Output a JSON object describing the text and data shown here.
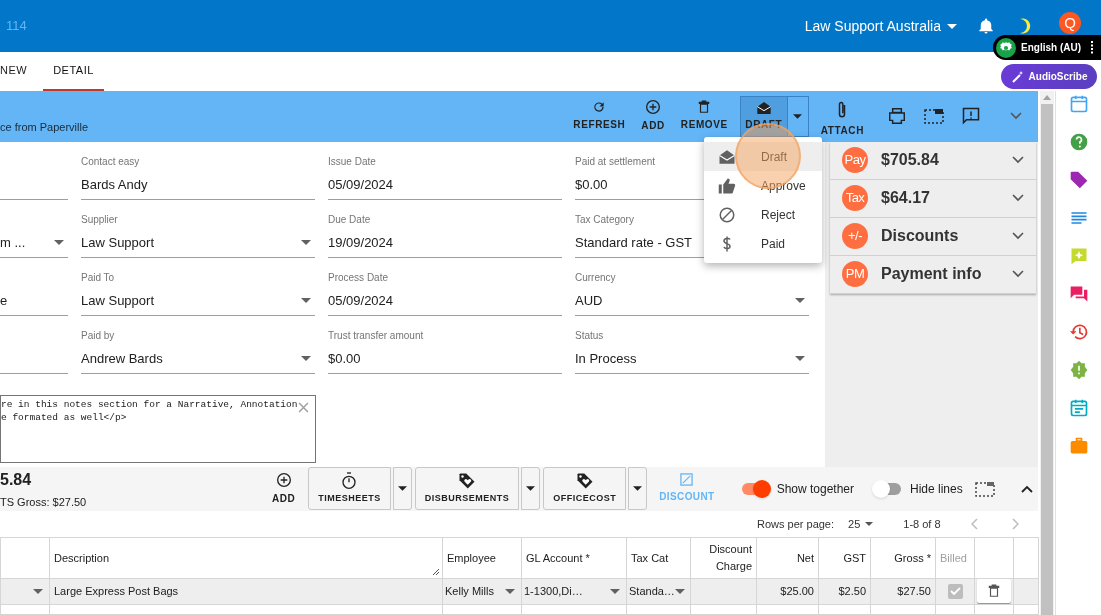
{
  "header": {
    "record_number": "114",
    "organisation": "Law Support Australia",
    "avatar_initial": "Q"
  },
  "overlays": {
    "language": "English (AU)",
    "assistant": "AudioScribe"
  },
  "tabs": [
    {
      "label": "NEW",
      "selected": false
    },
    {
      "label": "DETAIL",
      "selected": true
    }
  ],
  "toolbar": {
    "subtitle": "ce from Paperville",
    "buttons": [
      {
        "kind": "refresh",
        "label": "REFRESH"
      },
      {
        "kind": "add",
        "label": "ADD"
      },
      {
        "kind": "remove",
        "label": "REMOVE"
      },
      {
        "kind": "split",
        "label": "DRAFT"
      },
      {
        "kind": "attach",
        "label": "ATTACH"
      }
    ]
  },
  "status_menu": [
    {
      "label": "Draft",
      "selected": true
    },
    {
      "label": "Approve",
      "selected": false
    },
    {
      "label": "Reject",
      "selected": false
    },
    {
      "label": "Paid",
      "selected": false
    }
  ],
  "form": {
    "fields": [
      {
        "kind": "text"
      },
      {
        "kind": "text",
        "label": "Contact easy",
        "value": "Bards Andy"
      },
      {
        "kind": "text",
        "label": "Issue Date",
        "value": "05/09/2024"
      },
      {
        "kind": "text",
        "label": "Paid at settlement",
        "value": "$0.00"
      },
      {
        "kind": "select",
        "value": "m ..."
      },
      {
        "kind": "select",
        "label": "Supplier",
        "value": "Law Support"
      },
      {
        "kind": "text",
        "label": "Due Date",
        "value": "19/09/2024"
      },
      {
        "kind": "text",
        "label": "Tax Category",
        "value": "Standard rate - GST"
      },
      {
        "kind": "text",
        "value": "e"
      },
      {
        "kind": "select",
        "label": "Paid To",
        "value": "Law Support"
      },
      {
        "kind": "text",
        "label": "Process Date",
        "value": "05/09/2024"
      },
      {
        "kind": "select",
        "label": "Currency",
        "value": "AUD"
      },
      {
        "kind": "text"
      },
      {
        "kind": "select",
        "label": "Paid by",
        "value": "Andrew Bards"
      },
      {
        "kind": "text",
        "label": "Trust transfer amount",
        "value": "$0.00"
      },
      {
        "kind": "select",
        "label": "Status",
        "value": "In Process"
      }
    ],
    "notes": [
      "re in this notes section for a Narrative, Annotation",
      "e formated as well</p>"
    ]
  },
  "summary": [
    {
      "badge": "Pay",
      "label": "$705.84"
    },
    {
      "badge": "Tax",
      "label": "$64.17"
    },
    {
      "badge": "+/-",
      "label": "Discounts"
    },
    {
      "badge": "PM",
      "label": "Payment info"
    }
  ],
  "lines_toolbar": {
    "total": "5.84",
    "ts_gross": "TS Gross: $27.50",
    "add": "ADD",
    "buttons": [
      {
        "kind": "timer",
        "label": "TIMESHEETS"
      },
      {
        "kind": "tag",
        "label": "DISBURSEMENTS"
      },
      {
        "kind": "tag",
        "label": "OFFICECOST"
      }
    ],
    "discount": "DISCOUNT",
    "toggles": [
      {
        "label": "Show together",
        "on": true
      },
      {
        "label": "Hide lines",
        "on": false
      }
    ]
  },
  "pagination": {
    "rows_per_page_label": "Rows per page:",
    "rows_per_page": "25",
    "range": "1-8 of 8"
  },
  "table": {
    "columns": [
      {
        "label": "Description"
      },
      {
        "label": "Employee"
      },
      {
        "label": "GL Account *"
      },
      {
        "label": "Tax Cat"
      },
      {
        "label": "Discount Charge"
      },
      {
        "label": "Net"
      },
      {
        "label": "GST"
      },
      {
        "label": "Gross *"
      },
      {
        "label": "Billed",
        "disabled": true
      }
    ],
    "rows": [
      {
        "description": "Large Express Post Bags",
        "employee": "Kelly Mills",
        "gl_account": "1-1300,Di…",
        "tax_cat": "Standa…",
        "net": "$25.00",
        "gst": "$2.50",
        "gross": "$27.50",
        "billed": true
      }
    ]
  }
}
